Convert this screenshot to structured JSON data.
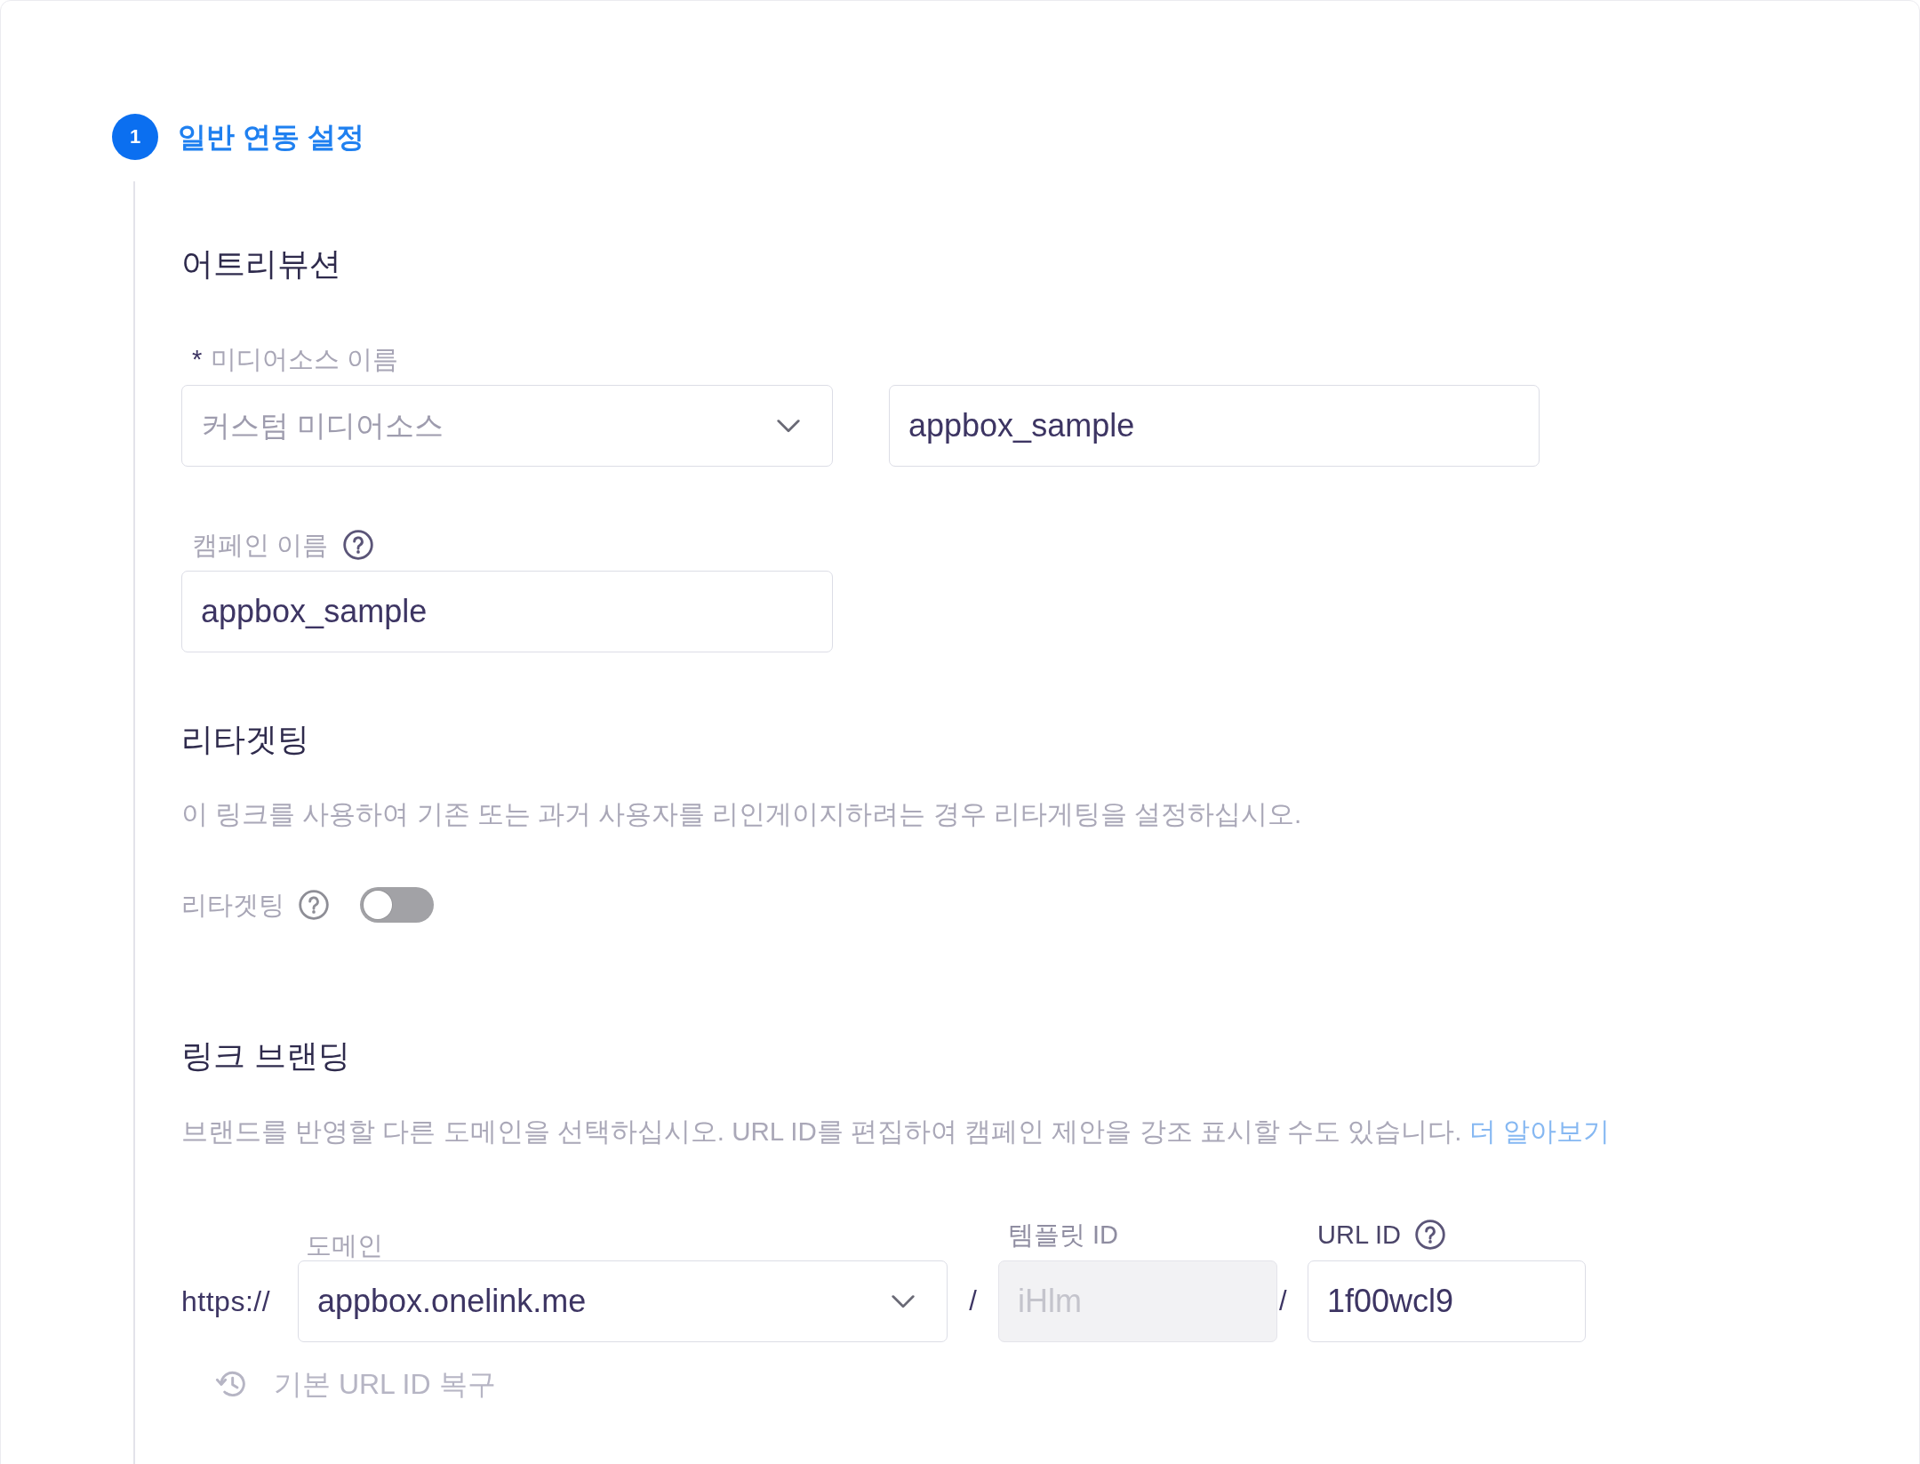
{
  "step": {
    "number": "1",
    "title": "일반 연동 설정"
  },
  "attribution": {
    "heading": "어트리뷰션",
    "media_source": {
      "required_mark": "*",
      "label": "미디어소스 이름",
      "dropdown": {
        "placeholder": "커스텀 미디어소스"
      },
      "custom_name": {
        "value": "appbox_sample"
      }
    },
    "campaign": {
      "label": "캠페인 이름",
      "value": "appbox_sample"
    }
  },
  "retargeting": {
    "heading": "리타겟팅",
    "description": "이 링크를 사용하여 기존 또는 과거 사용자를 리인게이지하려는 경우 리타게팅을 설정하십시오.",
    "toggle": {
      "label": "리타겟팅",
      "on": false
    }
  },
  "link_branding": {
    "heading": "링크 브랜딩",
    "description": "브랜드를 반영할 다른 도메인을 선택하십시오. URL ID를 편집하여 캠페인 제안을 강조 표시할 수도 있습니다.",
    "learn_more_link": "더 알아보기",
    "prefix": "https://",
    "domain": {
      "label": "도메인",
      "value": "appbox.onelink.me"
    },
    "separators": [
      "/",
      "/"
    ],
    "template_id": {
      "label": "템플릿 ID",
      "value": "iHlm",
      "disabled": true
    },
    "url_id": {
      "label": "URL ID",
      "value": "1f00wcl9"
    },
    "restore_button": {
      "label": "기본 URL ID 복구",
      "disabled": true
    }
  }
}
